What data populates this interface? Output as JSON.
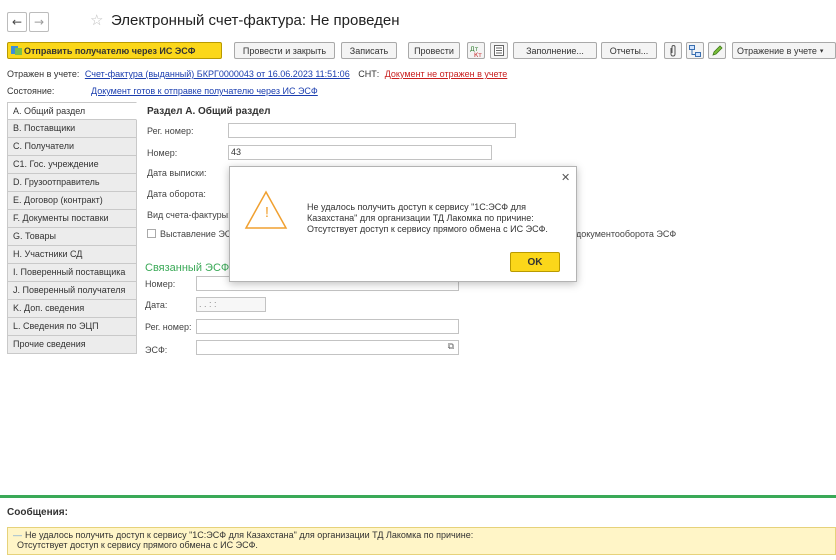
{
  "window": {
    "title": "Электронный счет-фактура: Не проведен",
    "back_glyph": "←",
    "forward_glyph": "→",
    "star_glyph": "☆"
  },
  "toolbar": {
    "send_label": "Отправить получателю через ИС ЭСФ",
    "post_close_label": "Провести и закрыть",
    "write_label": "Записать",
    "post_label": "Провести",
    "dtkt_label": "Дт Кт",
    "fill_label": "Заполнение...",
    "reports_label": "Отчеты...",
    "reflect_label": "Отражение в учете"
  },
  "header_info": {
    "reflected_label": "Отражен в учете:",
    "reflected_link": "Счет-фактура (выданный) БКРГ0000043 от 16.06.2023 11:51:06",
    "snt_label": "СНТ:",
    "snt_link": "Документ не отражен в учете",
    "state_label": "Состояние:",
    "state_link": "Документ готов к отправке получателю через ИС ЭСФ"
  },
  "nav": {
    "items": [
      {
        "label": "А. Общий раздел"
      },
      {
        "label": "В. Поставщики"
      },
      {
        "label": "С. Получатели"
      },
      {
        "label": "С1. Гос. учреждение"
      },
      {
        "label": "D. Грузоотправитель"
      },
      {
        "label": "E. Договор (контракт)"
      },
      {
        "label": "F. Документы поставки"
      },
      {
        "label": "G. Товары"
      },
      {
        "label": "H. Участники СД"
      },
      {
        "label": "I. Поверенный поставщика"
      },
      {
        "label": "J. Поверенный получателя"
      },
      {
        "label": "K. Доп. сведения"
      },
      {
        "label": "L. Сведения по ЭЦП"
      },
      {
        "label": "Прочие сведения"
      }
    ]
  },
  "form": {
    "section_title": "Раздел А. Общий раздел",
    "reg_number_label": "Рег. номер:",
    "reg_number_value": "",
    "number_label": "Номер:",
    "number_value": "43",
    "date_issue_label": "Дата выписки:",
    "date_turnover_label": "Дата оборота:",
    "invoice_type_label": "Вид счета-фактуры:",
    "exhibition_partial": "Выставление ЭС",
    "flow_partial": "документооборота ЭСФ",
    "related_partial": "Связанный ЭСФ",
    "related_number_label": "Номер:",
    "related_date_label": "Дата:",
    "related_date_value": ". .   : :",
    "related_reg_label": "Рег. номер:",
    "related_esf_label": "ЭСФ:"
  },
  "messages": {
    "title": "Сообщения:",
    "line1": "Не удалось получить доступ к сервису \"1С:ЭСФ для Казахстана\" для организации ТД Лакомка по причине:",
    "line2": "Отсутствует доступ к сервису прямого обмена с ИС ЭСФ."
  },
  "modal": {
    "text": "Не удалось получить доступ к сервису \"1С:ЭСФ для Казахстана\" для организации ТД Лакомка по причине: Отсутствует доступ к сервису прямого обмена с ИС ЭСФ.",
    "ok_label": "OK",
    "close_glyph": "✕",
    "warning_glyph": "!"
  },
  "colors": {
    "accent_yellow": "#fbd71a",
    "link_blue": "#1b3eaf",
    "link_red": "#c81e1e",
    "section_green": "#3aa957",
    "warning_orange": "#f0a030"
  }
}
